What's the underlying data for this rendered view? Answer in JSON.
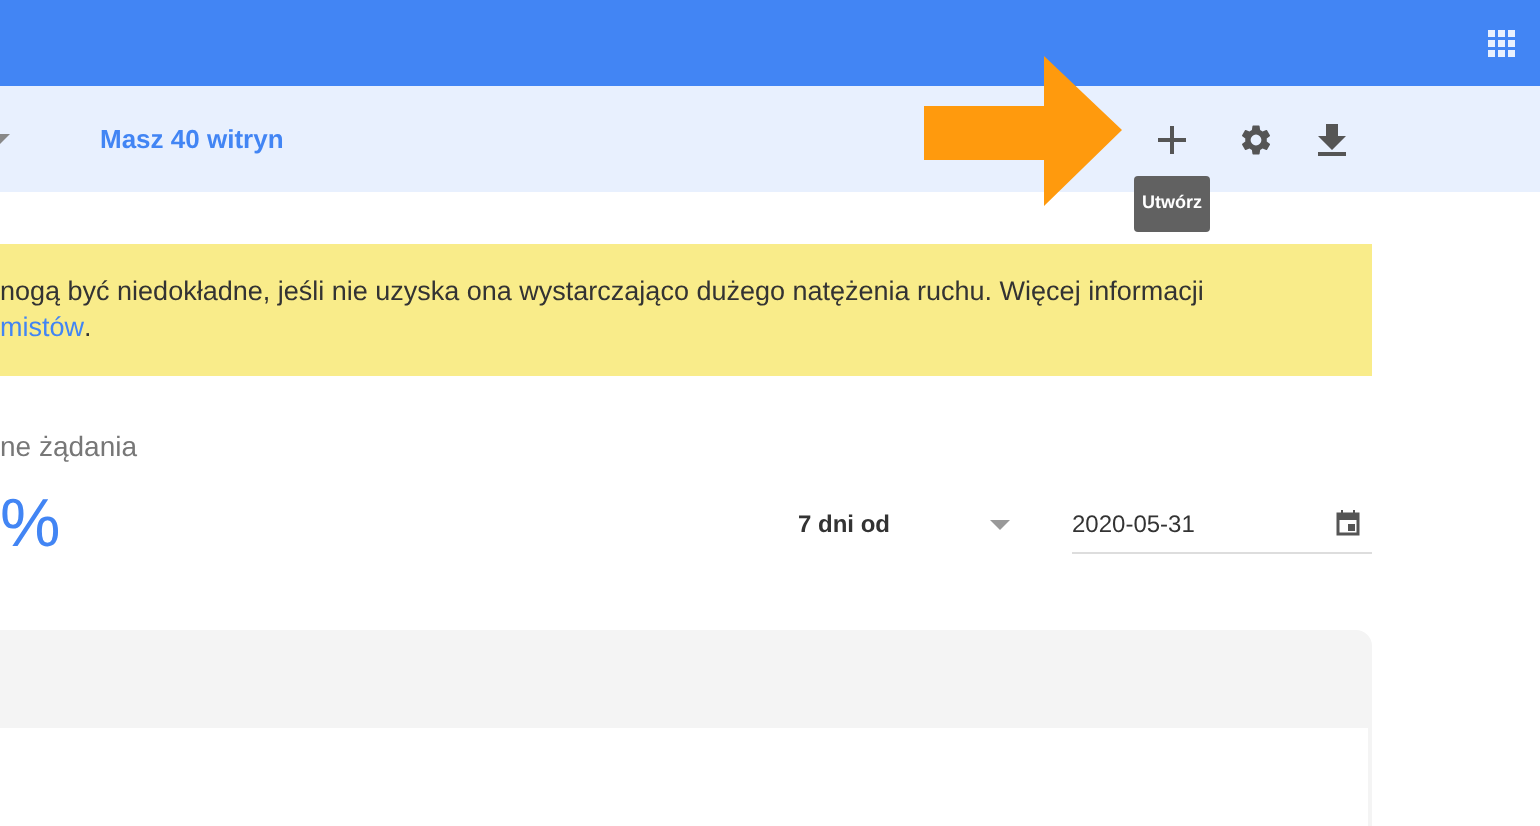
{
  "toolbar": {
    "site_count": "Masz 40 witryn",
    "tooltip": "Utwórz"
  },
  "notice": {
    "line_1": "nogą być niedokładne, jeśli nie uzyska ona wystarczająco dużego natężenia ruchu. Więcej informacji",
    "link": "mistów",
    "after_link": "."
  },
  "metric": {
    "label": "ne żądania",
    "value": "%"
  },
  "range": {
    "label": "7 dni od",
    "date": "2020-05-31"
  }
}
